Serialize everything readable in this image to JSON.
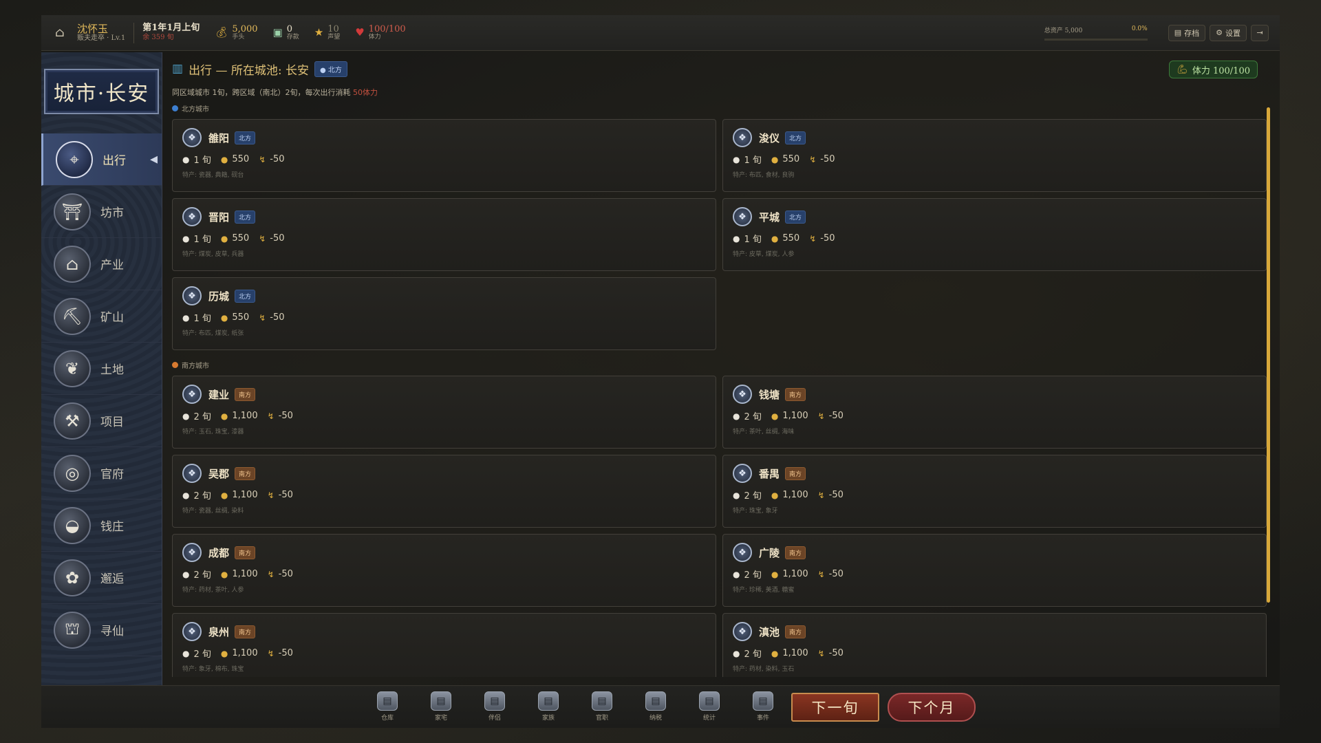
{
  "topbar": {
    "player_name": "沈怀玉",
    "player_rank": "贩夫走卒 · Lv.1",
    "date_main": "第1年1月上旬",
    "date_sub": "余 359 旬",
    "cash_value": "5,000",
    "cash_label": "手头",
    "deposit_value": "0",
    "deposit_label": "存款",
    "reputation_value": "10",
    "reputation_label": "声望",
    "health_value": "100/100",
    "health_label": "体力",
    "total_assets_label": "总资产 5,000",
    "total_assets_pct": "0.0%",
    "save_label": "存档",
    "settings_label": "设置"
  },
  "sidebar": {
    "city_title": "城市·长安",
    "items": [
      {
        "label": "出行",
        "icon": "map-pin-icon"
      },
      {
        "label": "坊市",
        "icon": "market-icon"
      },
      {
        "label": "产业",
        "icon": "building-icon"
      },
      {
        "label": "矿山",
        "icon": "pickaxe-icon"
      },
      {
        "label": "土地",
        "icon": "wheat-icon"
      },
      {
        "label": "项目",
        "icon": "hammer-icon"
      },
      {
        "label": "官府",
        "icon": "drum-icon"
      },
      {
        "label": "钱庄",
        "icon": "ingot-icon"
      },
      {
        "label": "邂逅",
        "icon": "lotus-icon"
      },
      {
        "label": "寻仙",
        "icon": "pavilion-icon"
      }
    ]
  },
  "main": {
    "title": "出行 — 所在城池: 长安",
    "current_region": "北方",
    "stamina": "体力 100/100",
    "rule_text": "同区域城市 1旬，跨区域（南北）2旬，每次出行消耗 ",
    "rule_cost": "50体力",
    "north_label": "北方城市",
    "south_label": "南方城市",
    "north_cities": [
      {
        "name": "雒阳",
        "region": "北方",
        "time": "1 旬",
        "cost": "550",
        "stamina": "-50",
        "spec": "特产: 瓷器, 典籍, 砚台"
      },
      {
        "name": "浚仪",
        "region": "北方",
        "time": "1 旬",
        "cost": "550",
        "stamina": "-50",
        "spec": "特产: 布匹, 食材, 良驹"
      },
      {
        "name": "晋阳",
        "region": "北方",
        "time": "1 旬",
        "cost": "550",
        "stamina": "-50",
        "spec": "特产: 煤炭, 皮草, 兵器"
      },
      {
        "name": "平城",
        "region": "北方",
        "time": "1 旬",
        "cost": "550",
        "stamina": "-50",
        "spec": "特产: 皮草, 煤炭, 人参"
      },
      {
        "name": "历城",
        "region": "北方",
        "time": "1 旬",
        "cost": "550",
        "stamina": "-50",
        "spec": "特产: 布匹, 煤炭, 纸张"
      }
    ],
    "south_cities": [
      {
        "name": "建业",
        "region": "南方",
        "time": "2 旬",
        "cost": "1,100",
        "stamina": "-50",
        "spec": "特产: 玉石, 珠宝, 漆器"
      },
      {
        "name": "钱塘",
        "region": "南方",
        "time": "2 旬",
        "cost": "1,100",
        "stamina": "-50",
        "spec": "特产: 茶叶, 丝绸, 海味"
      },
      {
        "name": "吴郡",
        "region": "南方",
        "time": "2 旬",
        "cost": "1,100",
        "stamina": "-50",
        "spec": "特产: 瓷器, 丝绸, 染料"
      },
      {
        "name": "番禺",
        "region": "南方",
        "time": "2 旬",
        "cost": "1,100",
        "stamina": "-50",
        "spec": "特产: 珠宝, 象牙"
      },
      {
        "name": "成都",
        "region": "南方",
        "time": "2 旬",
        "cost": "1,100",
        "stamina": "-50",
        "spec": "特产: 药材, 茶叶, 人参"
      },
      {
        "name": "广陵",
        "region": "南方",
        "time": "2 旬",
        "cost": "1,100",
        "stamina": "-50",
        "spec": "特产: 珍稀, 美酒, 糖蜜"
      },
      {
        "name": "泉州",
        "region": "南方",
        "time": "2 旬",
        "cost": "1,100",
        "stamina": "-50",
        "spec": "特产: 象牙, 棉布, 珠宝"
      },
      {
        "name": "滇池",
        "region": "南方",
        "time": "2 旬",
        "cost": "1,100",
        "stamina": "-50",
        "spec": "特产: 药材, 染料, 玉石"
      }
    ]
  },
  "bottombar": {
    "items": [
      "仓库",
      "家宅",
      "伴侣",
      "家族",
      "官职",
      "纳税",
      "统计",
      "事件"
    ],
    "next_period": "下一旬",
    "next_month": "下个月"
  },
  "colors": {
    "gold": "#e0b85a",
    "north_badge": "#27406a",
    "south_badge": "#6b4426",
    "stamina_green": "#1e3a1f",
    "scroll_accent": "#d8a83a"
  }
}
